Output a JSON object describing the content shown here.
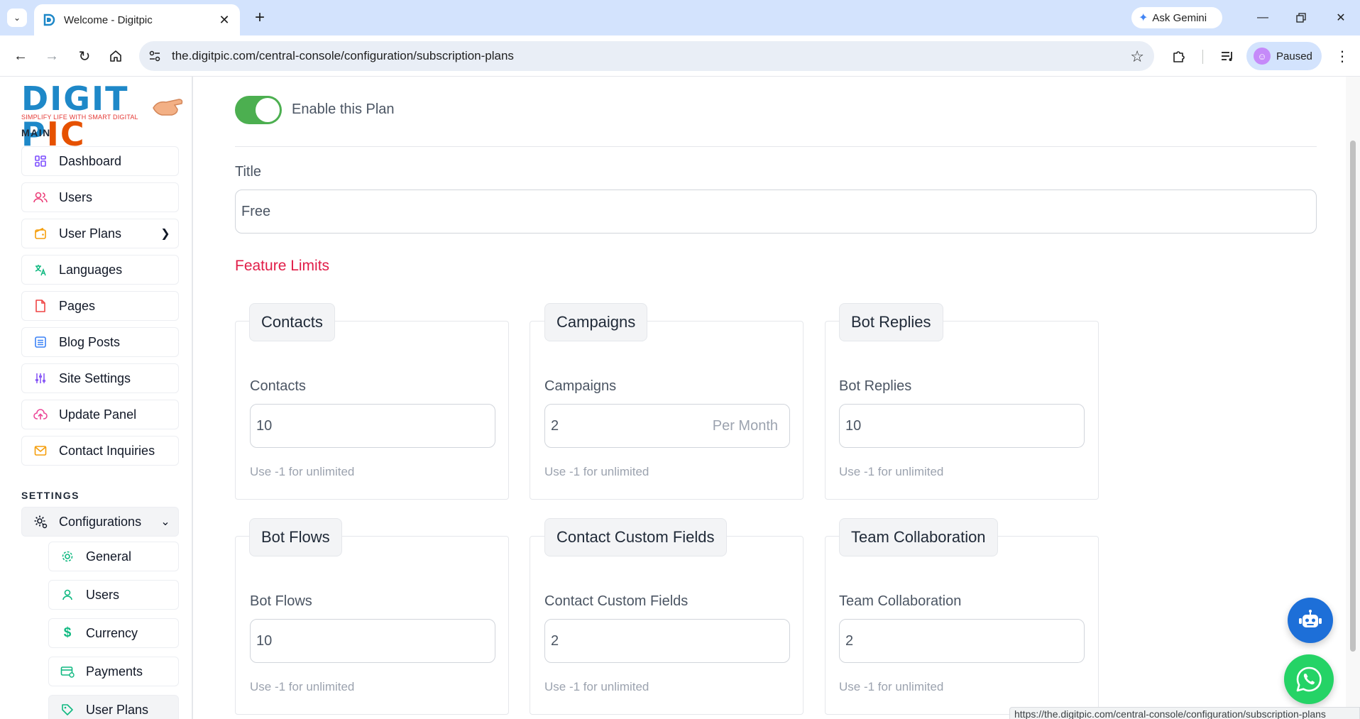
{
  "browser": {
    "tab_title": "Welcome - Digitpic",
    "gemini_label": "Ask Gemini",
    "url": "the.digitpic.com/central-console/configuration/subscription-plans",
    "profile_label": "Paused",
    "status_url": "https://the.digitpic.com/central-console/configuration/subscription-plans"
  },
  "brand": {
    "logo_text_1": "DIGIT P",
    "logo_text_2": "IC",
    "tagline": "SIMPLIFY LIFE WITH SMART DIGITAL",
    "accent_blue": "#1e88c8",
    "accent_orange": "#e65100"
  },
  "sidebar": {
    "main_label": "MAIN",
    "settings_label": "SETTINGS",
    "main_items": [
      {
        "label": "Dashboard",
        "icon": "dashboard-icon"
      },
      {
        "label": "Users",
        "icon": "users-icon"
      },
      {
        "label": "User Plans",
        "icon": "wallet-icon"
      },
      {
        "label": "Languages",
        "icon": "translate-icon"
      },
      {
        "label": "Pages",
        "icon": "file-icon"
      },
      {
        "label": "Blog Posts",
        "icon": "list-icon"
      },
      {
        "label": "Site Settings",
        "icon": "sliders-icon"
      },
      {
        "label": "Update Panel",
        "icon": "cloud-upload-icon"
      },
      {
        "label": "Contact Inquiries",
        "icon": "mail-icon"
      }
    ],
    "configurations_label": "Configurations",
    "sub_items": [
      {
        "label": "General",
        "icon": "gear-icon"
      },
      {
        "label": "Users",
        "icon": "user-icon"
      },
      {
        "label": "Currency",
        "icon": "dollar-icon"
      },
      {
        "label": "Payments",
        "icon": "payment-icon"
      },
      {
        "label": "User Plans",
        "icon": "tag-icon"
      }
    ]
  },
  "plan": {
    "enabled": true,
    "toggle_label": "Enable this Plan",
    "title_label": "Title",
    "title_value": "Free",
    "feature_limits_label": "Feature Limits",
    "toggle_color": "#4caf50",
    "section_color": "#e11d48"
  },
  "features": [
    {
      "legend": "Contacts",
      "label": "Contacts",
      "value": "10",
      "suffix": "",
      "hint": "Use -1 for unlimited"
    },
    {
      "legend": "Campaigns",
      "label": "Campaigns",
      "value": "2",
      "suffix": "Per Month",
      "hint": "Use -1 for unlimited"
    },
    {
      "legend": "Bot Replies",
      "label": "Bot Replies",
      "value": "10",
      "suffix": "",
      "hint": "Use -1 for unlimited"
    },
    {
      "legend": "Bot Flows",
      "label": "Bot Flows",
      "value": "10",
      "suffix": "",
      "hint": "Use -1 for unlimited"
    },
    {
      "legend": "Contact Custom Fields",
      "label": "Contact Custom Fields",
      "value": "2",
      "suffix": "",
      "hint": "Use -1 for unlimited"
    },
    {
      "legend": "Team Collaboration",
      "label": "Team Collaboration",
      "value": "2",
      "suffix": "",
      "hint": "Use -1 for unlimited"
    }
  ]
}
